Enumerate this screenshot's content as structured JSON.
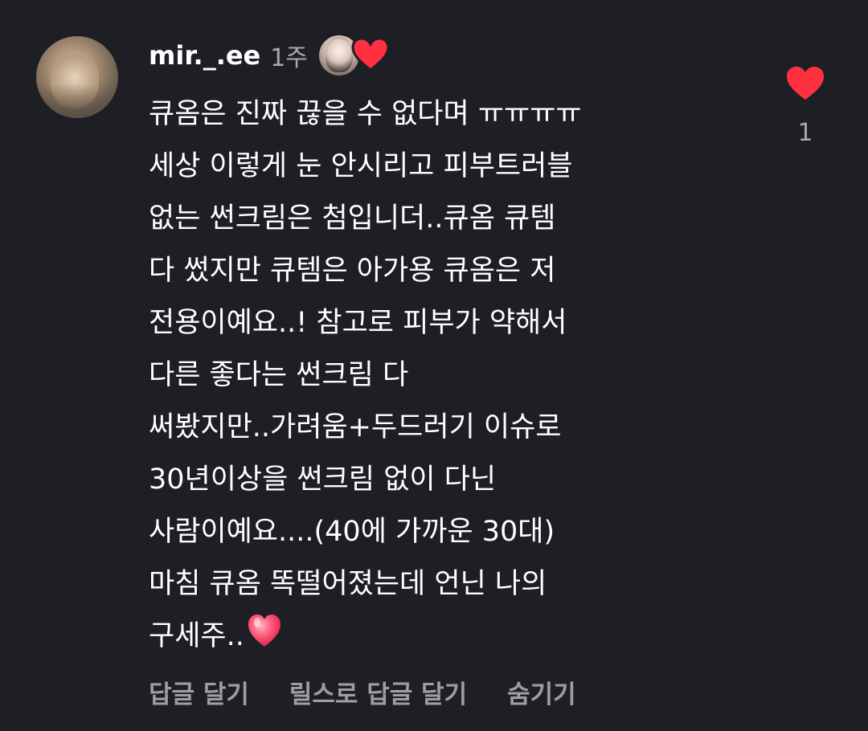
{
  "comment": {
    "username": "mir._.ee",
    "time": "1주",
    "lines": [
      "큐옴은 진짜 끊을 수 없다며 ㅠㅠㅠㅠ",
      "세상 이렇게 눈 안시리고 피부트러블",
      "없는 썬크림은 첨입니더..큐옴 큐템",
      "다 썼지만 큐템은 아가용 큐옴은 저",
      "전용이예요..! 참고로 피부가 약해서",
      "다른 좋다는 썬크림 다",
      "써봤지만..가려움+두드러기 이슈로",
      "30년이상을 썬크림 없이 다닌",
      "사람이예요....(40에 가까운 30대)",
      "마침 큐옴 똑떨어졌는데 언닌 나의",
      "구세주.."
    ],
    "like_count": "1"
  },
  "actions": {
    "reply": "답글 달기",
    "reels_reply": "릴스로 답글 달기",
    "hide": "숨기기"
  },
  "colors": {
    "background": "#1e1f24",
    "heart_red": "#ff3040",
    "muted_text": "#9d9ea3"
  },
  "icons": {
    "like": "heart-icon",
    "creator_like": "creator-heart-icon",
    "inline_emoji": "pink-heart-emoji"
  }
}
